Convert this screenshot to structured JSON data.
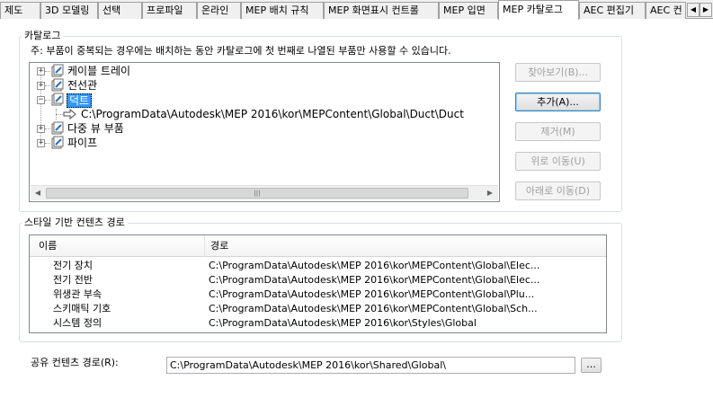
{
  "tabs": [
    {
      "label": "제도"
    },
    {
      "label": "3D 모델링"
    },
    {
      "label": "선택"
    },
    {
      "label": "프로파일"
    },
    {
      "label": "온라인"
    },
    {
      "label": "MEP 배치 규칙"
    },
    {
      "label": "MEP 화면표시 컨트롤"
    },
    {
      "label": "MEP 입면"
    },
    {
      "label": "MEP 카탈로그"
    },
    {
      "label": "AEC 편집기"
    },
    {
      "label": "AEC 컨"
    }
  ],
  "active_tab": "MEP 카탈로그",
  "tab_scroll": {
    "left": "◀",
    "right": "▶"
  },
  "catalog_group": {
    "legend": "카탈로그",
    "note": "주: 부품이 중복되는 경우에는 배치하는 동안 카탈로그에 첫 번째로 나열된 부품만 사용할 수 있습니다.",
    "tree": [
      {
        "label": "케이블 트레이",
        "expander": "+"
      },
      {
        "label": "전선관",
        "expander": "+"
      },
      {
        "label": "덕트",
        "expander": "−",
        "selected": true
      },
      {
        "label": "C:\\ProgramData\\Autodesk\\MEP 2016\\kor\\MEPContent\\Global\\Duct\\Duct"
      },
      {
        "label": "다중 뷰 부품",
        "expander": "+"
      },
      {
        "label": "파이프",
        "expander": "+"
      }
    ],
    "scroll": {
      "left": "◀",
      "right": "▶",
      "grip": "|||"
    },
    "buttons": {
      "browse": "찾아보기(B)...",
      "add": "추가(A)...",
      "remove": "제거(M)",
      "move_up": "위로 이동(U)",
      "move_down": "아래로 이동(D)"
    }
  },
  "style_group": {
    "legend": "스타일 기반 컨텐츠 경로",
    "columns": [
      "이름",
      "경로"
    ],
    "rows": [
      {
        "name": "전기 장치",
        "path": "C:\\ProgramData\\Autodesk\\MEP 2016\\kor\\MEPContent\\Global\\Elec..."
      },
      {
        "name": "전기 전반",
        "path": "C:\\ProgramData\\Autodesk\\MEP 2016\\kor\\MEPContent\\Global\\Elec..."
      },
      {
        "name": "위생관 부속",
        "path": "C:\\ProgramData\\Autodesk\\MEP 2016\\kor\\MEPContent\\Global\\Plu..."
      },
      {
        "name": "스키매틱 기호",
        "path": "C:\\ProgramData\\Autodesk\\MEP 2016\\kor\\MEPContent\\Global\\Sch..."
      },
      {
        "name": "시스템 정의",
        "path": "C:\\ProgramData\\Autodesk\\MEP 2016\\kor\\Styles\\Global"
      }
    ]
  },
  "shared_content": {
    "label": "공유 컨텐츠 경로(R):",
    "value": "C:\\ProgramData\\Autodesk\\MEP 2016\\kor\\Shared\\Global\\",
    "browse_button": "..."
  }
}
